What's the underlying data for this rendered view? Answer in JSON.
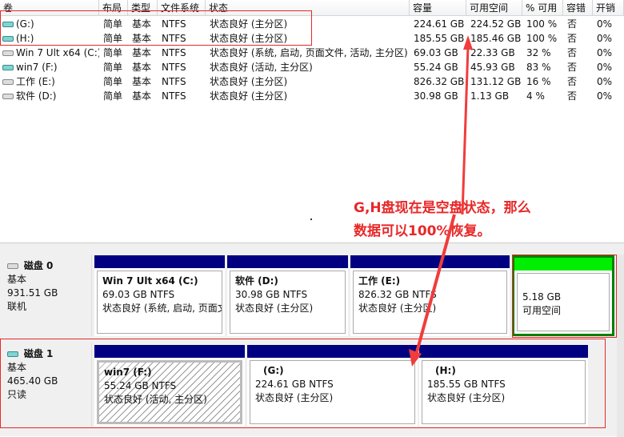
{
  "columns": [
    "卷",
    "布局",
    "类型",
    "文件系统",
    "状态",
    "容量",
    "可用空间",
    "% 可用",
    "容错",
    "开销"
  ],
  "volumes": [
    {
      "name": "(G:)",
      "layout": "简单",
      "type": "基本",
      "fs": "NTFS",
      "status": "状态良好 (主分区)",
      "capacity": "224.61 GB",
      "free": "224.52 GB",
      "pct": "100 %",
      "ft": "否",
      "overhead": "0%",
      "icon": "teal"
    },
    {
      "name": "(H:)",
      "layout": "简单",
      "type": "基本",
      "fs": "NTFS",
      "status": "状态良好 (主分区)",
      "capacity": "185.55 GB",
      "free": "185.46 GB",
      "pct": "100 %",
      "ft": "否",
      "overhead": "0%",
      "icon": "teal"
    },
    {
      "name": "Win 7 Ult x64 (C:)",
      "layout": "简单",
      "type": "基本",
      "fs": "NTFS",
      "status": "状态良好 (系统, 启动, 页面文件, 活动, 主分区)",
      "capacity": "69.03 GB",
      "free": "22.33 GB",
      "pct": "32 %",
      "ft": "否",
      "overhead": "0%",
      "icon": "gray"
    },
    {
      "name": "win7 (F:)",
      "layout": "简单",
      "type": "基本",
      "fs": "NTFS",
      "status": "状态良好 (活动, 主分区)",
      "capacity": "55.24 GB",
      "free": "45.93 GB",
      "pct": "83 %",
      "ft": "否",
      "overhead": "0%",
      "icon": "teal"
    },
    {
      "name": "工作 (E:)",
      "layout": "简单",
      "type": "基本",
      "fs": "NTFS",
      "status": "状态良好 (主分区)",
      "capacity": "826.32 GB",
      "free": "131.12 GB",
      "pct": "16 %",
      "ft": "否",
      "overhead": "0%",
      "icon": "gray"
    },
    {
      "name": "软件 (D:)",
      "layout": "简单",
      "type": "基本",
      "fs": "NTFS",
      "status": "状态良好 (主分区)",
      "capacity": "30.98 GB",
      "free": "1.13 GB",
      "pct": "4 %",
      "ft": "否",
      "overhead": "0%",
      "icon": "gray"
    }
  ],
  "annotation": {
    "line1": "G,H盘现在是空盘状态，那么",
    "line2": "数据可以100%恢复。",
    "color": "#e82828"
  },
  "disks": [
    {
      "name": "磁盘 0",
      "type": "基本",
      "size": "931.51 GB",
      "state": "联机",
      "parts": [
        {
          "title": "Win 7 Ult x64  (C:)",
          "size": "69.03 GB NTFS",
          "status": "状态良好 (系统, 启动, 页面文件"
        },
        {
          "title": "软件  (D:)",
          "size": "30.98 GB NTFS",
          "status": "状态良好 (主分区)"
        },
        {
          "title": "工作  (E:)",
          "size": "826.32 GB NTFS",
          "status": "状态良好 (主分区)"
        },
        {
          "size": "5.18 GB",
          "status": "可用空间"
        }
      ]
    },
    {
      "name": "磁盘 1",
      "type": "基本",
      "size": "465.40 GB",
      "state": "只读",
      "parts": [
        {
          "title": "win7  (F:)",
          "size": "55.24 GB NTFS",
          "status": "状态良好 (活动, 主分区)"
        },
        {
          "title": "(G:)",
          "size": "224.61 GB NTFS",
          "status": "状态良好 (主分区)"
        },
        {
          "title": "(H:)",
          "size": "185.55 GB NTFS",
          "status": "状态良好 (主分区)"
        }
      ]
    }
  ],
  "colors": {
    "partition_bar": "#000080",
    "unallocated": "#00ee00",
    "highlight": "#e82828"
  }
}
